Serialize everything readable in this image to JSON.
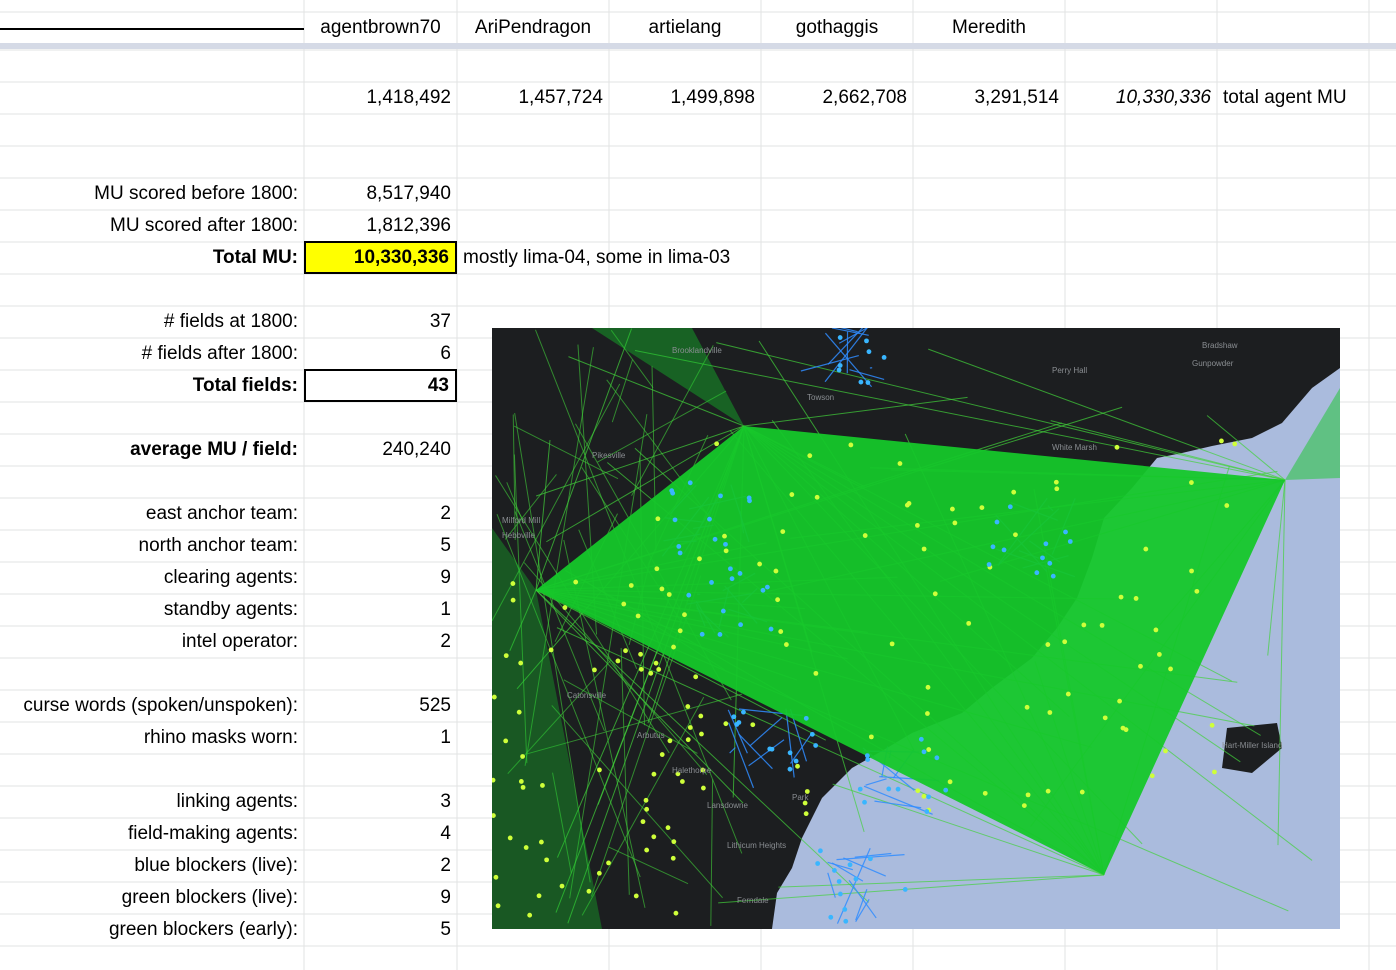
{
  "header": {
    "players": [
      "agentbrown70",
      "AriPendragon",
      "artielang",
      "gothaggis",
      "Meredith"
    ]
  },
  "totals_row": {
    "values": [
      "1,418,492",
      "1,457,724",
      "1,499,898",
      "2,662,708",
      "3,291,514"
    ],
    "sum": "10,330,336",
    "sum_label": "total agent MU"
  },
  "mu": {
    "before_label": "MU scored before 1800:",
    "before_value": "8,517,940",
    "after_label": "MU scored after 1800:",
    "after_value": "1,812,396",
    "total_label": "Total MU:",
    "total_value": "10,330,336",
    "note": "mostly lima-04, some in lima-03"
  },
  "fields": {
    "at_label": "# fields at 1800:",
    "at_value": "37",
    "after_label": "# fields after 1800:",
    "after_value": "6",
    "total_label": "Total fields:",
    "total_value": "43"
  },
  "average": {
    "label": "average MU / field:",
    "value": "240,240"
  },
  "teams": [
    {
      "label": "east anchor team:",
      "value": "2"
    },
    {
      "label": "north anchor team:",
      "value": "5"
    },
    {
      "label": "clearing agents:",
      "value": "9"
    },
    {
      "label": "standby agents:",
      "value": "1"
    },
    {
      "label": "intel operator:",
      "value": "2"
    }
  ],
  "misc": [
    {
      "label": "curse words (spoken/unspoken):",
      "value": "525"
    },
    {
      "label": "rhino masks worn:",
      "value": "1"
    }
  ],
  "agents": [
    {
      "label": "linking agents:",
      "value": "3"
    },
    {
      "label": "field-making agents:",
      "value": "4"
    },
    {
      "label": "blue blockers (live):",
      "value": "2"
    },
    {
      "label": "green blockers (live):",
      "value": "9"
    },
    {
      "label": "green blockers (early):",
      "value": "5"
    }
  ],
  "map": {
    "place_labels": [
      "Brooklandville",
      "Towson",
      "Perry Hall",
      "Bradshaw",
      "Gunpowder",
      "White Marsh",
      "Pikesville",
      "Milford Mill",
      "Hebbville",
      "Catonsville",
      "Arbutus",
      "Halethorpe",
      "Lansdowne",
      "Park",
      "Lithicum Heights",
      "Ferndale",
      "Hart-Miller Island"
    ],
    "colors": {
      "background": "#1c1e20",
      "water": "#aabbdd",
      "field": "#15c72a",
      "link_green": "#41d13a",
      "link_blue": "#2f8cff",
      "portal_yellow": "#cfff3a",
      "portal_blue": "#39b6ff"
    }
  }
}
